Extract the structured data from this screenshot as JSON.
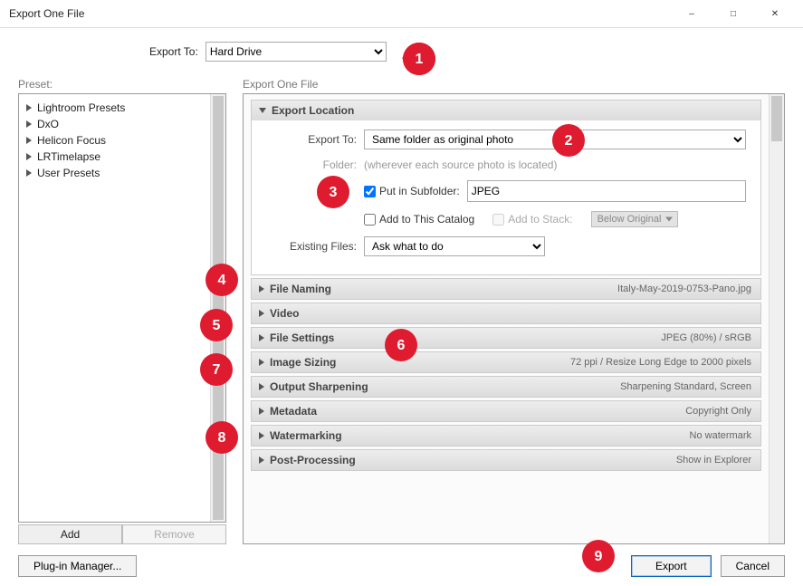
{
  "window": {
    "title": "Export One File"
  },
  "top": {
    "export_to_label": "Export To:",
    "export_to_value": "Hard Drive"
  },
  "preset": {
    "label": "Preset:",
    "items": [
      "Lightroom Presets",
      "DxO",
      "Helicon Focus",
      "LRTimelapse",
      "User Presets"
    ],
    "add_label": "Add",
    "remove_label": "Remove"
  },
  "right": {
    "label": "Export One File",
    "sections": {
      "export_location": {
        "title": "Export Location",
        "export_to_label": "Export To:",
        "export_to_value": "Same folder as original photo",
        "folder_label": "Folder:",
        "folder_value": "(wherever each source photo is located)",
        "put_in_subfolder_label": "Put in Subfolder:",
        "put_in_subfolder_checked": true,
        "subfolder_value": "JPEG",
        "add_to_catalog_label": "Add to This Catalog",
        "add_to_catalog_checked": false,
        "add_to_stack_label": "Add to Stack:",
        "add_to_stack_checked": false,
        "stack_position": "Below Original",
        "existing_files_label": "Existing Files:",
        "existing_files_value": "Ask what to do"
      },
      "file_naming": {
        "title": "File Naming",
        "summary": "Italy-May-2019-0753-Pano.jpg"
      },
      "video": {
        "title": "Video",
        "summary": ""
      },
      "file_settings": {
        "title": "File Settings",
        "summary": "JPEG (80%) / sRGB"
      },
      "image_sizing": {
        "title": "Image Sizing",
        "summary": "72 ppi / Resize Long Edge to 2000 pixels"
      },
      "output_sharpening": {
        "title": "Output Sharpening",
        "summary": "Sharpening Standard, Screen"
      },
      "metadata": {
        "title": "Metadata",
        "summary": "Copyright Only"
      },
      "watermarking": {
        "title": "Watermarking",
        "summary": "No watermark"
      },
      "post_processing": {
        "title": "Post-Processing",
        "summary": "Show in Explorer"
      }
    }
  },
  "footer": {
    "plugin_manager": "Plug-in Manager...",
    "export": "Export",
    "cancel": "Cancel"
  },
  "callouts": [
    "1",
    "2",
    "3",
    "4",
    "5",
    "6",
    "7",
    "8",
    "9"
  ]
}
